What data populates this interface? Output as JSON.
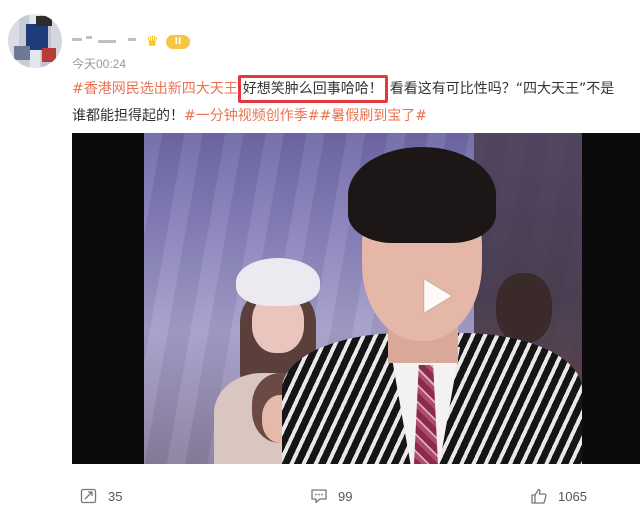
{
  "post": {
    "timestamp": "今天00:24",
    "vip_level": "II",
    "text_line1": {
      "tag_prefix": "#香港网民选出新四大天王",
      "highlighted": "好想笑肿么回事哈哈！",
      "rest": "看看这有可比性吗？“四大天王”不是"
    },
    "text_line2": {
      "plain": "谁都能担得起的！",
      "tags": "#一分钟视频创作季##暑假刷到宝了#"
    }
  },
  "video": {
    "play_icon": "play-icon"
  },
  "actions": {
    "repost_count": "35",
    "comment_count": "99",
    "like_count": "1065"
  },
  "colors": {
    "tag": "#eb7350",
    "highlight_border": "#e4383d",
    "vip_gold": "#f6c544"
  }
}
